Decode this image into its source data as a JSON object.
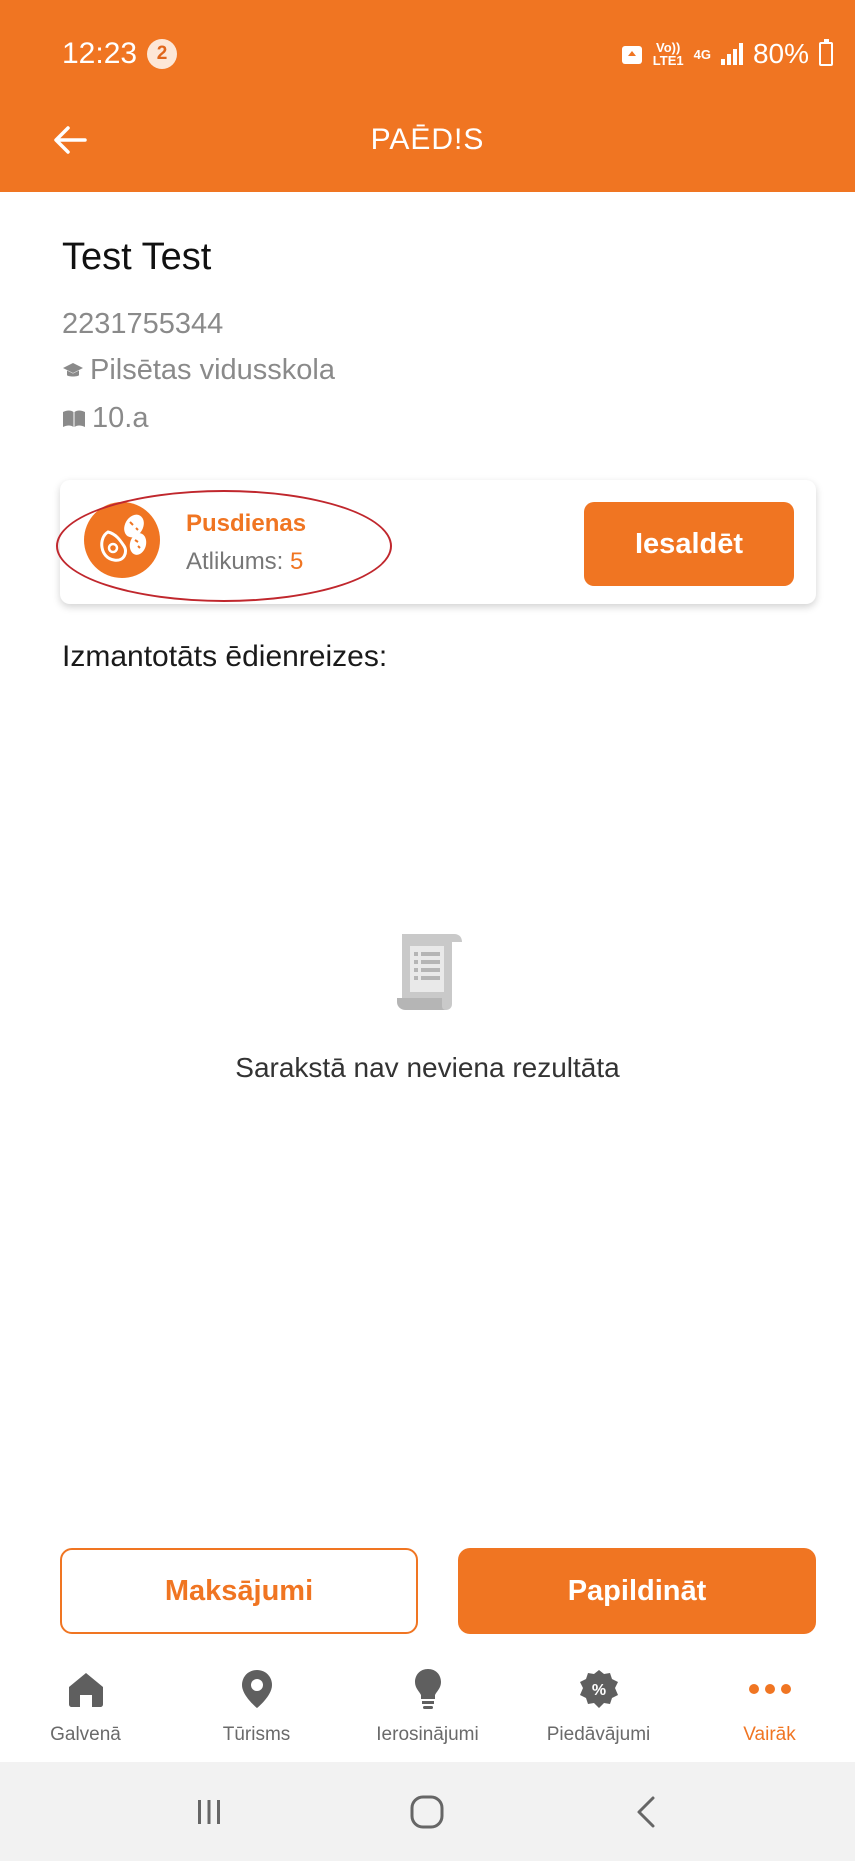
{
  "status_bar": {
    "time": "12:23",
    "notification_count": "2",
    "network_top": "Vo))",
    "network_bottom": "LTE1",
    "network_type": "4G",
    "battery_percent": "80%"
  },
  "app_bar": {
    "title": "PAĒD!S",
    "back_icon": "arrow-left-icon"
  },
  "profile": {
    "name": "Test Test",
    "id_number": "2231755344",
    "school": "Pilsētas vidusskola",
    "school_icon": "graduation-cap-icon",
    "class": "10.a",
    "class_icon": "book-icon"
  },
  "meal_card": {
    "meal_name": "Pusdienas",
    "balance_label": "Atlikums: ",
    "balance_value": "5",
    "freeze_button": "Iesaldēt",
    "icon": "meal-icon"
  },
  "section_label": "Izmantotāts ēdienreizes:",
  "empty_state": {
    "icon": "document-scroll-icon",
    "text": "Sarakstā nav neviena rezultāta"
  },
  "actions": {
    "payments_button": "Maksājumi",
    "topup_button": "Papildināt"
  },
  "bottom_nav": {
    "items": [
      {
        "label": "Galvenā",
        "icon": "home-icon"
      },
      {
        "label": "Tūrisms",
        "icon": "location-pin-icon"
      },
      {
        "label": "Ierosinājumi",
        "icon": "lightbulb-icon"
      },
      {
        "label": "Piedāvājumi",
        "icon": "discount-badge-icon"
      },
      {
        "label": "Vairāk",
        "icon": "more-dots-icon"
      }
    ],
    "active_index": 4
  },
  "colors": {
    "accent": "#f07522",
    "annotation_ellipse": "#c0272d"
  }
}
